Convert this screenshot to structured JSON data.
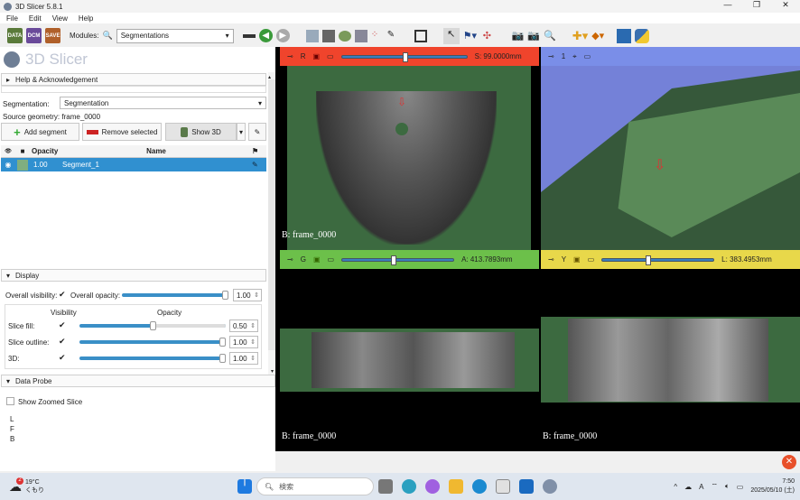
{
  "app": {
    "title": "3D Slicer 5.8.1",
    "logo_text": "3D Slicer"
  },
  "menu": [
    "File",
    "Edit",
    "View",
    "Help"
  ],
  "toolbar": {
    "data_label": "DATA",
    "dcm_label": "DCM",
    "save_label": "SAVE",
    "modules_label": "Modules:",
    "module_selected": "Segmentations"
  },
  "panel": {
    "help_section": "Help & Acknowledgement",
    "segmentation_label": "Segmentation:",
    "segmentation_value": "Segmentation",
    "source_geometry": "Source geometry: frame_0000",
    "add_segment": "Add segment",
    "remove_selected": "Remove selected",
    "show_3d": "Show 3D",
    "table": {
      "headers": [
        "Opacity",
        "Name"
      ],
      "rows": [
        {
          "opacity": "1.00",
          "name": "Segment_1",
          "color": "#80ae80"
        }
      ]
    },
    "display_section": "Display",
    "overall_visibility": "Overall visibility:",
    "overall_opacity": "Overall opacity:",
    "overall_opacity_value": "1.00",
    "visibility_header": "Visibility",
    "opacity_header": "Opacity",
    "rows": [
      {
        "label": "Slice fill:",
        "value": "0.50",
        "level": 0.5
      },
      {
        "label": "Slice outline:",
        "value": "1.00",
        "level": 1.0
      },
      {
        "label": "3D:",
        "value": "1.00",
        "level": 1.0
      }
    ],
    "overall_level": 1.0,
    "data_probe_section": "Data Probe",
    "show_zoomed_slice": "Show Zoomed Slice",
    "probe_lines": [
      "L",
      "F",
      "B"
    ]
  },
  "views": {
    "red": {
      "letter": "R",
      "offset": "S: 99.0000mm",
      "color": "#f0442c",
      "slider": 0.5,
      "label": "B: frame_0000"
    },
    "threeD": {
      "letter": "1",
      "color": "#7a8ee8"
    },
    "green": {
      "letter": "G",
      "offset": "A:  413.7893mm",
      "color": "#6cc04a",
      "slider": 0.45,
      "label": "B: frame_0000"
    },
    "yellow": {
      "letter": "Y",
      "offset": "L: 383.4953mm",
      "color": "#e8d84a",
      "slider": 0.4,
      "label": "B: frame_0000"
    }
  },
  "taskbar": {
    "weather_temp": "19°C",
    "weather_desc": "くもり",
    "weather_badge": "2",
    "search_placeholder": "検索",
    "time": "7:50",
    "date": "2025/05/10 (土)"
  }
}
